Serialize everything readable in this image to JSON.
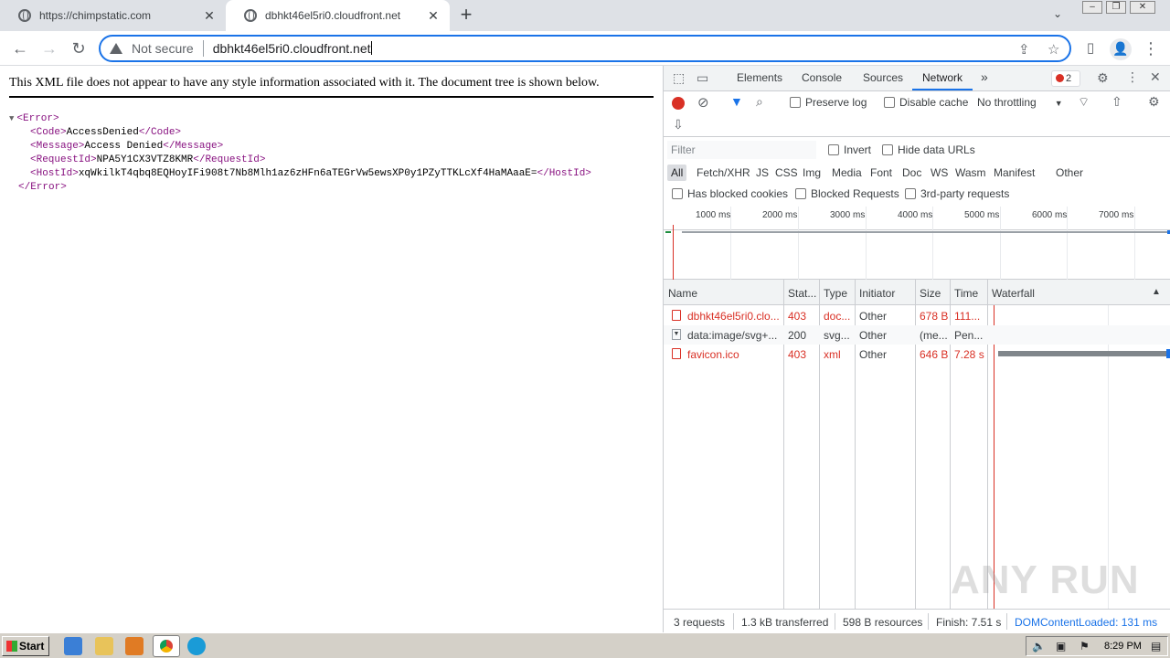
{
  "browser": {
    "tabs": [
      {
        "title": "https://chimpstatic.com"
      },
      {
        "title": "dbhkt46el5ri0.cloudfront.net"
      }
    ],
    "not_secure_label": "Not secure",
    "url": "dbhkt46el5ri0.cloudfront.net"
  },
  "page": {
    "xml_info": "This XML file does not appear to have any style information associated with it. The document tree is shown below.",
    "tree": {
      "root_open": "<Error>",
      "code_open": "<Code>",
      "code_value": "AccessDenied",
      "code_close": "</Code>",
      "message_open": "<Message>",
      "message_value": "Access Denied",
      "message_close": "</Message>",
      "requestid_open": "<RequestId>",
      "requestid_value": "NPA5Y1CX3VTZ8KMR",
      "requestid_close": "</RequestId>",
      "hostid_open": "<HostId>",
      "hostid_value": "xqWkilkT4qbq8EQHoyIFi908t7Nb8Mlh1az6zHFn6aTEGrVw5ewsXP0y1PZyTTKLcXf4HaMAaaE=",
      "hostid_close": "</HostId>",
      "root_close": "</Error>"
    }
  },
  "devtools": {
    "tabs": [
      "Elements",
      "Console",
      "Sources",
      "Network"
    ],
    "more": "»",
    "error_count": "2",
    "toolbar": {
      "preserve_log": "Preserve log",
      "disable_cache": "Disable cache",
      "throttling": "No throttling"
    },
    "filter": {
      "placeholder": "Filter",
      "invert": "Invert",
      "hide_data_urls": "Hide data URLs",
      "types": [
        "All",
        "Fetch/XHR",
        "JS",
        "CSS",
        "Img",
        "Media",
        "Font",
        "Doc",
        "WS",
        "Wasm",
        "Manifest",
        "Other"
      ],
      "has_blocked_cookies": "Has blocked cookies",
      "blocked_requests": "Blocked Requests",
      "third_party": "3rd-party requests"
    },
    "timeline_ticks": [
      "1000 ms",
      "2000 ms",
      "3000 ms",
      "4000 ms",
      "5000 ms",
      "6000 ms",
      "7000 ms"
    ],
    "columns": [
      "Name",
      "Stat...",
      "Type",
      "Initiator",
      "Size",
      "Time",
      "Waterfall"
    ],
    "rows": [
      {
        "name": "dbhkt46el5ri0.clo...",
        "status": "403",
        "type": "doc...",
        "initiator": "Other",
        "size": "678 B",
        "time": "111...",
        "error": true
      },
      {
        "name": "data:image/svg+...",
        "status": "200",
        "type": "svg...",
        "initiator": "Other",
        "size": "(me...",
        "time": "Pen...",
        "error": false
      },
      {
        "name": "favicon.ico",
        "status": "403",
        "type": "xml",
        "initiator": "Other",
        "size": "646 B",
        "time": "7.28 s",
        "error": true
      }
    ],
    "status": {
      "requests": "3 requests",
      "transferred": "1.3 kB transferred",
      "resources": "598 B resources",
      "finish": "Finish: 7.51 s",
      "dcl": "DOMContentLoaded: 131 ms"
    }
  },
  "taskbar": {
    "start": "Start",
    "clock": "8:29 PM"
  },
  "watermark": "ANY RUN",
  "colors": {
    "accent": "#1a73e8",
    "error": "#d93025",
    "xml_tag": "#881280"
  }
}
